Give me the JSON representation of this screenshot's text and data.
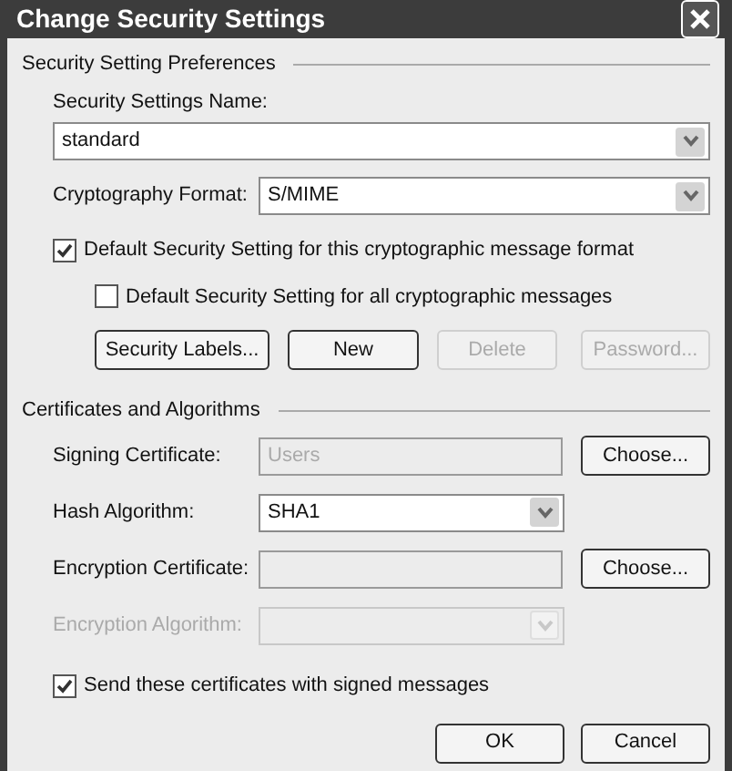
{
  "window": {
    "title": "Change Security Settings"
  },
  "preferences": {
    "heading": "Security Setting Preferences",
    "name_label": "Security Settings Name:",
    "name_value": "standard",
    "format_label": "Cryptography Format:",
    "format_value": "S/MIME",
    "checkboxes": [
      {
        "label": "Default Security Setting for this cryptographic message format",
        "checked": true
      },
      {
        "label": "Default Security Setting for all cryptographic messages",
        "checked": false
      }
    ],
    "buttons": [
      {
        "label": "Security Labels...",
        "disabled": false
      },
      {
        "label": "New",
        "disabled": false
      },
      {
        "label": "Delete",
        "disabled": true
      },
      {
        "label": "Password...",
        "disabled": true
      }
    ]
  },
  "certificates": {
    "heading": "Certificates and Algorithms",
    "rows": [
      {
        "kind": "field",
        "label": "Signing Certificate:",
        "value": "Users",
        "button": "Choose..."
      },
      {
        "kind": "combo",
        "label": "Hash Algorithm:",
        "value": "SHA1",
        "disabled": false
      },
      {
        "kind": "field",
        "label": "Encryption Certificate:",
        "button": "Choose..."
      },
      {
        "kind": "combo",
        "label": "Encryption Algorithm:",
        "disabled": true
      }
    ],
    "send_checkbox": {
      "label": "Send these certificates with signed messages",
      "checked": true
    }
  },
  "dialog_buttons": [
    "OK",
    "Cancel"
  ]
}
